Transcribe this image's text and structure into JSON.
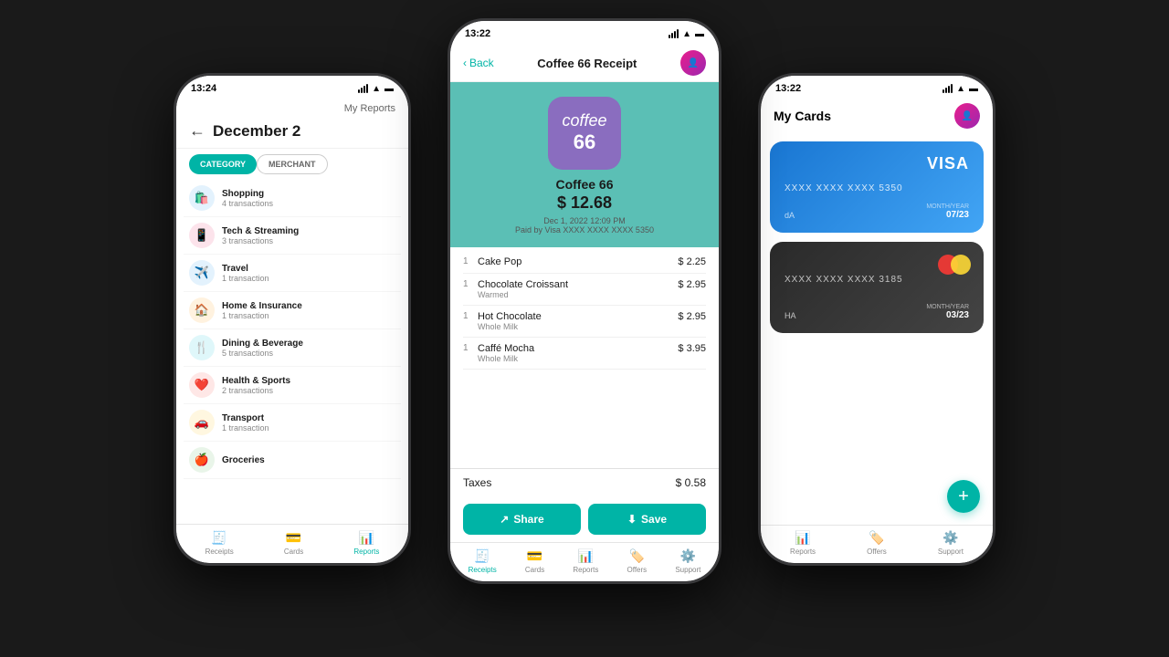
{
  "left_phone": {
    "status_time": "13:24",
    "header_title": "My Reports",
    "page_title": "December 2",
    "tabs": [
      {
        "label": "CATEGORY",
        "active": true
      },
      {
        "label": "MERCHANT",
        "active": false
      }
    ],
    "categories": [
      {
        "name": "Shopping",
        "sub": "4 transactions",
        "icon": "🛍️",
        "color": "#2196f3"
      },
      {
        "name": "Tech & Streaming",
        "sub": "3 transactions",
        "icon": "📱",
        "color": "#e91e63"
      },
      {
        "name": "Travel",
        "sub": "1 transaction",
        "icon": "✈️",
        "color": "#2196f3"
      },
      {
        "name": "Home & Insurance",
        "sub": "1 transaction",
        "icon": "🏠",
        "color": "#ff9800"
      },
      {
        "name": "Dining & Beverage",
        "sub": "5 transactions",
        "icon": "🍴",
        "color": "#00bcd4"
      },
      {
        "name": "Health & Sports",
        "sub": "2 transactions",
        "icon": "❤️",
        "color": "#f44336"
      },
      {
        "name": "Transport",
        "sub": "1 transaction",
        "icon": "🚗",
        "color": "#ffc107"
      },
      {
        "name": "Groceries",
        "sub": "",
        "icon": "🍎",
        "color": "#4caf50"
      }
    ],
    "bottom_nav": [
      {
        "label": "Receipts",
        "icon": "🧾",
        "active": false
      },
      {
        "label": "Cards",
        "icon": "💳",
        "active": false
      },
      {
        "label": "Reports",
        "icon": "📊",
        "active": true
      }
    ]
  },
  "center_phone": {
    "status_time": "13:22",
    "header": {
      "back_label": "Back",
      "title": "Coffee 66 Receipt"
    },
    "merchant": {
      "logo_text": "coffee",
      "logo_num": "66",
      "name": "Coffee 66",
      "amount": "$ 12.68",
      "date": "Dec 1, 2022 12:09 PM",
      "payment": "Paid by Visa  XXXX XXXX XXXX 5350"
    },
    "items": [
      {
        "qty": "1",
        "name": "Cake Pop",
        "sub": "",
        "price": "$ 2.25"
      },
      {
        "qty": "1",
        "name": "Chocolate Croissant",
        "sub": "Warmed",
        "price": "$ 2.95"
      },
      {
        "qty": "1",
        "name": "Hot Chocolate",
        "sub": "Whole Milk",
        "price": "$ 2.95"
      },
      {
        "qty": "1",
        "name": "Caffé Mocha",
        "sub": "Whole Milk",
        "price": "$ 3.95"
      }
    ],
    "taxes_label": "Taxes",
    "taxes_amount": "$ 0.58",
    "actions": [
      {
        "label": "Share",
        "icon": "↗"
      },
      {
        "label": "Save",
        "icon": "⬇"
      }
    ],
    "bottom_nav": [
      {
        "label": "Receipts",
        "icon": "🧾",
        "active": true
      },
      {
        "label": "Cards",
        "icon": "💳",
        "active": false
      },
      {
        "label": "Reports",
        "icon": "📊",
        "active": false
      },
      {
        "label": "Offers",
        "icon": "🏷️",
        "active": false
      },
      {
        "label": "Support",
        "icon": "⚙️",
        "active": false
      }
    ]
  },
  "right_phone": {
    "status_time": "13:22",
    "header_title": "My Cards",
    "cards": [
      {
        "type": "visa",
        "brand": "VISA",
        "number": "XXXX  XXXX  XXXX  5350",
        "holder": "dA",
        "expiry_label": "MONTH/YEAR",
        "expiry": "07/23"
      },
      {
        "type": "mastercard",
        "brand": "",
        "number": "XXXX  XXXX  XXXX  3185",
        "holder": "HA",
        "expiry_label": "MONTH/YEAR",
        "expiry": "03/23"
      }
    ],
    "bottom_nav": [
      {
        "label": "Reports",
        "icon": "📊",
        "active": false
      },
      {
        "label": "Offers",
        "icon": "🏷️",
        "active": false
      },
      {
        "label": "Support",
        "icon": "⚙️",
        "active": false
      }
    ]
  }
}
